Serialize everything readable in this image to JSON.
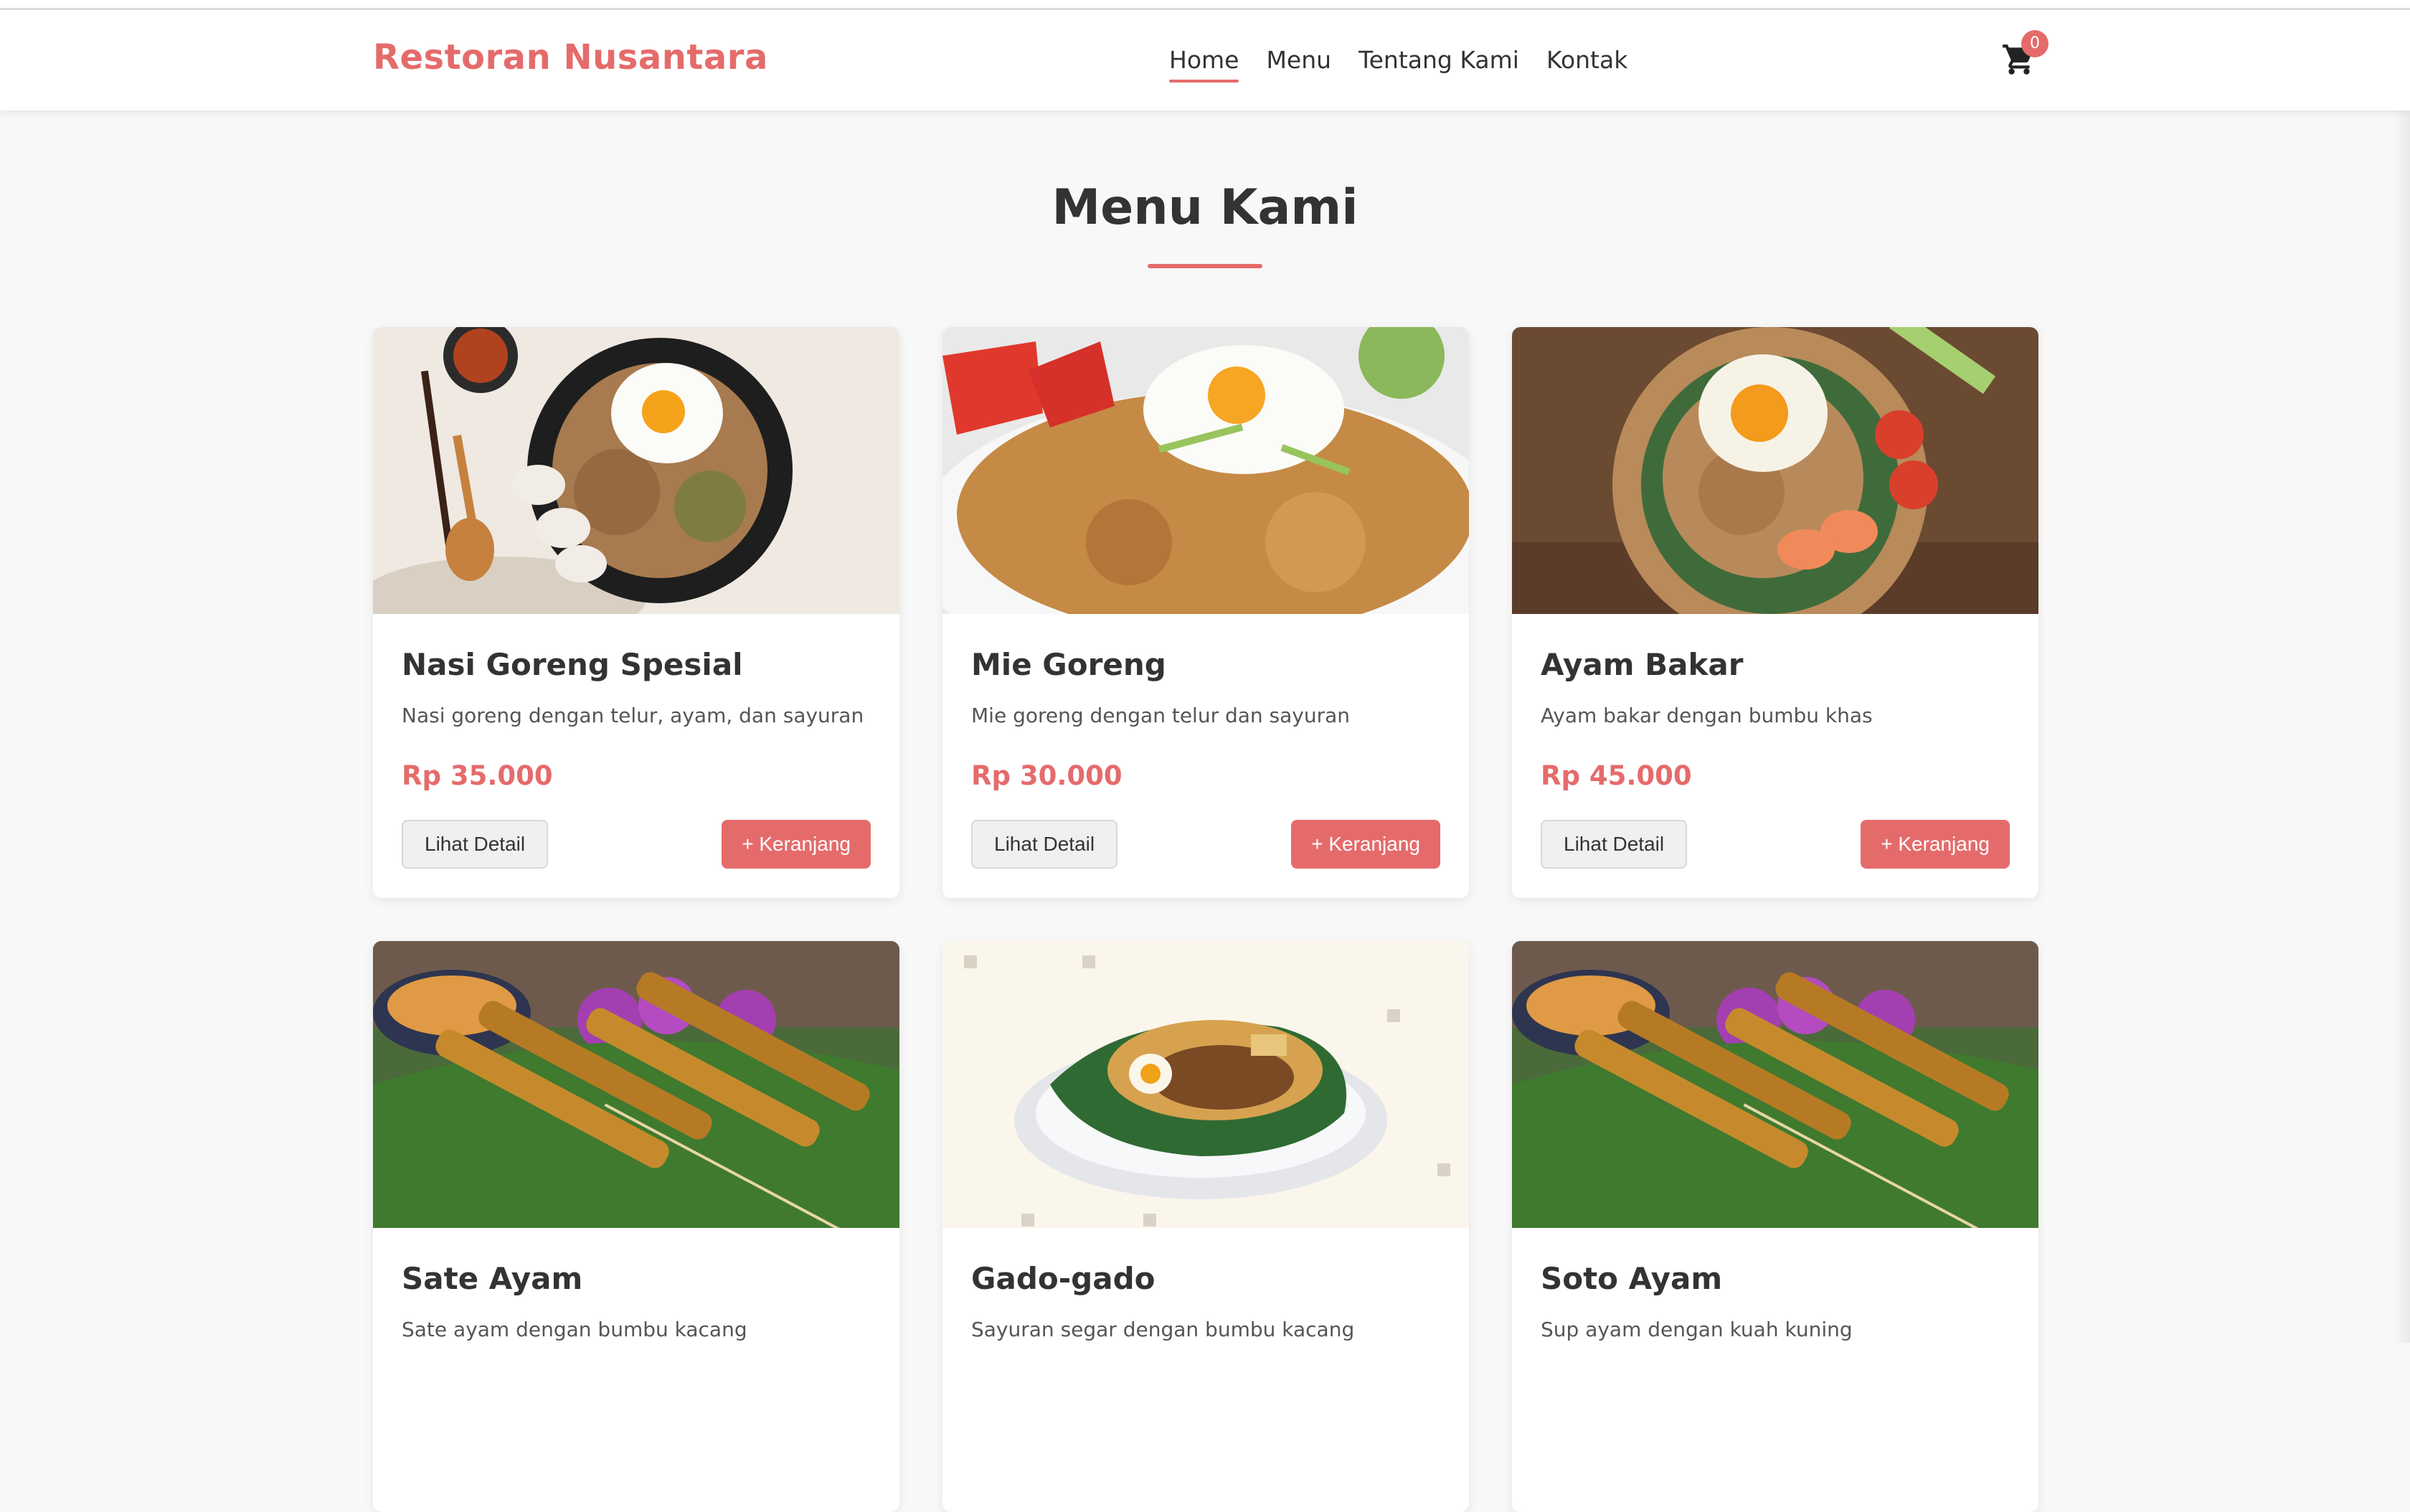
{
  "brand": "Restoran Nusantara",
  "nav": [
    "Home",
    "Menu",
    "Tentang Kami",
    "Kontak"
  ],
  "cart": {
    "count": "0",
    "icon": "cart-icon"
  },
  "section": {
    "title": "Menu Kami"
  },
  "buttons": {
    "detail": "Lihat Detail",
    "add": "+ Keranjang"
  },
  "colors": {
    "accent": "#e56b6b",
    "background": "#f8f8f8",
    "card": "#ffffff"
  },
  "menu": [
    {
      "name": "Nasi Goreng Spesial",
      "desc": "Nasi goreng dengan telur, ayam, dan sayuran",
      "price": "Rp 35.000",
      "image": "fried-rice-photo"
    },
    {
      "name": "Mie Goreng",
      "desc": "Mie goreng dengan telur dan sayuran",
      "price": "Rp 30.000",
      "image": "fried-noodle-photo"
    },
    {
      "name": "Ayam Bakar",
      "desc": "Ayam bakar dengan bumbu khas",
      "price": "Rp 45.000",
      "image": "grilled-chicken-photo"
    },
    {
      "name": "Sate Ayam",
      "desc": "Sate ayam dengan bumbu kacang",
      "price": "",
      "image": "satay-photo"
    },
    {
      "name": "Gado-gado",
      "desc": "Sayuran segar dengan bumbu kacang",
      "price": "",
      "image": "gado-gado-illustration"
    },
    {
      "name": "Soto Ayam",
      "desc": "Sup ayam dengan kuah kuning",
      "price": "",
      "image": "satay-photo"
    }
  ]
}
